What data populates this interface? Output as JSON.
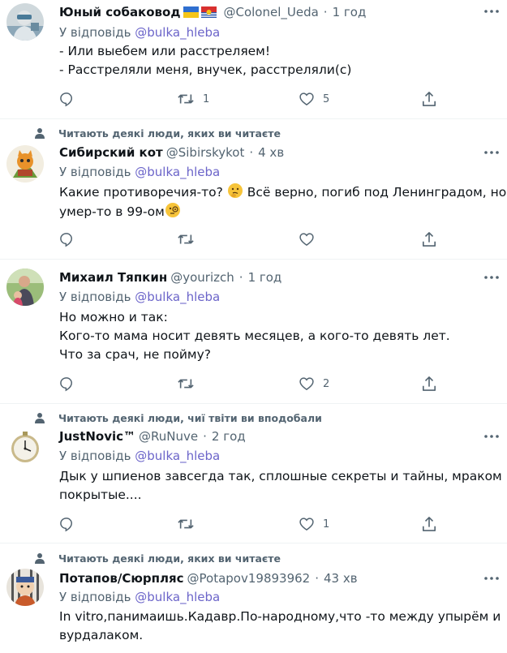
{
  "tweets": [
    {
      "social_context": "",
      "name": "Юный собаковод",
      "flags": [
        "Ukraine flag",
        "Kiribati flag"
      ],
      "handle": "@Colonel_Ueda",
      "time": "1 год",
      "reply_prefix": "У відповідь",
      "reply_to": "@bulka_hleba",
      "lines": [
        "- Или выебем или расстреляем!",
        "- Расстреляли меня, внучек, расстреляли(с)"
      ],
      "counts": {
        "reply": "",
        "retweet": "1",
        "like": "5"
      }
    },
    {
      "social_context": "Читають деякі люди, яких ви читаєте",
      "name": "Сибирский кот",
      "handle": "@Sibirskykot",
      "time": "4 хв",
      "reply_prefix": "У відповідь",
      "reply_to": "@bulka_hleba",
      "lines": [
        "Какие противоречия-то?",
        "Всё верно, погиб под Ленинградом, но,",
        "умер-то в 99-ом"
      ],
      "emojis": [
        "thinking-face",
        "face-with-monocle"
      ],
      "counts": {
        "reply": "",
        "retweet": "",
        "like": ""
      }
    },
    {
      "social_context": "",
      "name": "Михаил Тяпкин",
      "handle": "@yourizch",
      "time": "1 год",
      "reply_prefix": "У відповідь",
      "reply_to": "@bulka_hleba",
      "lines": [
        "Но можно и так:",
        "Кого-то мама носит девять месяцев, а кого-то девять лет.",
        "Что за срач, не пойму?"
      ],
      "counts": {
        "reply": "",
        "retweet": "",
        "like": "2"
      }
    },
    {
      "social_context": "Читають деякі люди, чиї твіти ви вподобали",
      "name": "JustNovic™",
      "handle": "@RuNuve",
      "time": "2 год",
      "reply_prefix": "У відповідь",
      "reply_to": "@bulka_hleba",
      "lines": [
        "Дык у шпиенов завсегда так, сплошные секреты и тайны, мраком",
        "покрытые...."
      ],
      "counts": {
        "reply": "",
        "retweet": "",
        "like": "1"
      }
    },
    {
      "social_context": "Читають деякі люди, яких ви читаєте",
      "name": "Потапов/Сюрпляс",
      "handle": "@Potapov19893962",
      "time": "43 хв",
      "reply_prefix": "У відповідь",
      "reply_to": "@bulka_hleba",
      "lines": [
        "In vitro,панимаишь.Кадавр.По-народному,что -то между упырём и",
        "вурдалаком."
      ],
      "counts": {
        "reply": "",
        "retweet": "",
        "like": ""
      }
    }
  ],
  "colors": {
    "text": "#0f1419",
    "secondary": "#536471",
    "mention": "#6b64c9",
    "divider": "#eff3f4"
  },
  "icons": {
    "reply": "reply-icon",
    "retweet": "retweet-icon",
    "like": "heart-icon",
    "share": "share-icon",
    "more": "more-icon",
    "social": "person-icon"
  }
}
